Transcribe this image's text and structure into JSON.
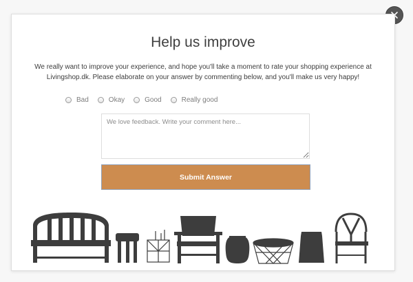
{
  "modal": {
    "title": "Help us improve",
    "description": "We really want to improve your experience, and hope you'll take a moment to rate your shopping experience at Livingshop.dk. Please elaborate on your answer by commenting below, and you'll make us very happy!",
    "rating_options": [
      {
        "label": "Bad",
        "selected": false
      },
      {
        "label": "Okay",
        "selected": false
      },
      {
        "label": "Good",
        "selected": false
      },
      {
        "label": "Really good",
        "selected": false
      }
    ],
    "comment": {
      "value": "",
      "placeholder": "We love feedback. Write your comment here..."
    },
    "submit_label": "Submit Answer"
  },
  "icons": {
    "close": "close-icon",
    "furniture": [
      "bench-icon",
      "stool-icon",
      "wire-basket-icon",
      "lounge-chair-icon",
      "vase-icon",
      "wire-basket-table-icon",
      "bin-icon",
      "wishbone-chair-icon"
    ]
  },
  "colors": {
    "accent": "#cd8c4f",
    "submit_text": "#ffffff",
    "title_text": "#3f3f3f",
    "furniture": "#3d3d3d",
    "close_button": "#555555"
  }
}
